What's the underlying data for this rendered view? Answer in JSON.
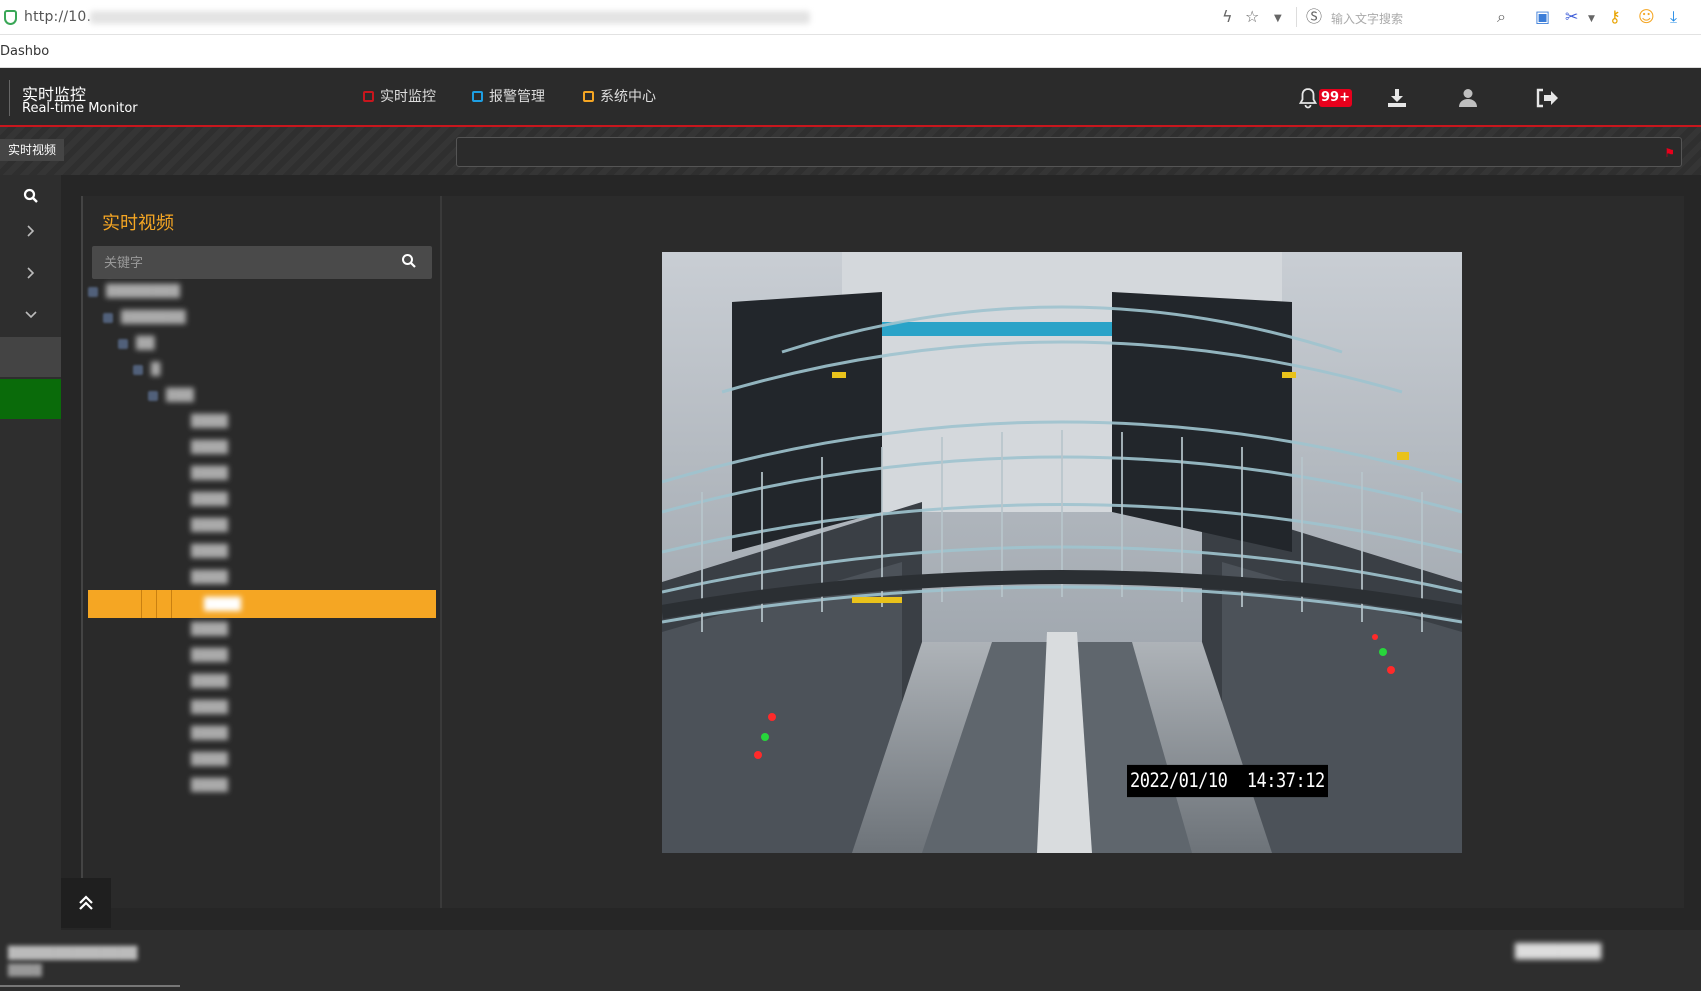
{
  "browser": {
    "url_prefix": "http://10.",
    "bookmark": "Dashbo",
    "search_placeholder": "输入文字搜索"
  },
  "header": {
    "title": "实时监控",
    "subtitle": "Real-time Monitor",
    "tabs": [
      {
        "label": "实时监控",
        "color": "#c8161d",
        "active": true
      },
      {
        "label": "报警管理",
        "color": "#1e9fe3",
        "active": false
      },
      {
        "label": "系统中心",
        "color": "#f5a623",
        "active": false
      }
    ],
    "notification_badge": "99+",
    "icons": [
      "bell-icon",
      "download-icon",
      "user-icon",
      "logout-icon"
    ]
  },
  "subbar": {
    "tab_label": "实时视频"
  },
  "leftnav": {
    "icons": [
      "search-icon",
      "chevron-right-icon",
      "chevron-right-icon",
      "chevron-down-icon"
    ]
  },
  "tree": {
    "title": "实时视频",
    "search_placeholder": "关键字",
    "nodes": [
      {
        "label": "████████",
        "depth": 0
      },
      {
        "label": "███████",
        "depth": 1
      },
      {
        "label": "██",
        "depth": 2
      },
      {
        "label": "█",
        "depth": 3
      },
      {
        "label": "███",
        "depth": 4
      },
      {
        "label": "████",
        "depth": 5
      },
      {
        "label": "████",
        "depth": 5
      },
      {
        "label": "████",
        "depth": 5
      },
      {
        "label": "████",
        "depth": 5
      },
      {
        "label": "████",
        "depth": 5
      },
      {
        "label": "████",
        "depth": 5
      },
      {
        "label": "████",
        "depth": 5
      },
      {
        "label": "████",
        "depth": 5,
        "selected": true
      },
      {
        "label": "████",
        "depth": 5
      },
      {
        "label": "████",
        "depth": 5
      },
      {
        "label": "████",
        "depth": 5
      },
      {
        "label": "████",
        "depth": 5
      },
      {
        "label": "████",
        "depth": 5
      },
      {
        "label": "████",
        "depth": 5
      },
      {
        "label": "████",
        "depth": 5
      }
    ]
  },
  "video": {
    "timestamp": "2022/01/10  14:37:12"
  },
  "footer": {
    "line1": "██████████████",
    "line2": "████",
    "right": "████████"
  },
  "colors": {
    "accent_red": "#c8161d",
    "accent_orange": "#f5a623",
    "accent_blue": "#1e9fe3",
    "nav_green": "#0a6b0a"
  }
}
